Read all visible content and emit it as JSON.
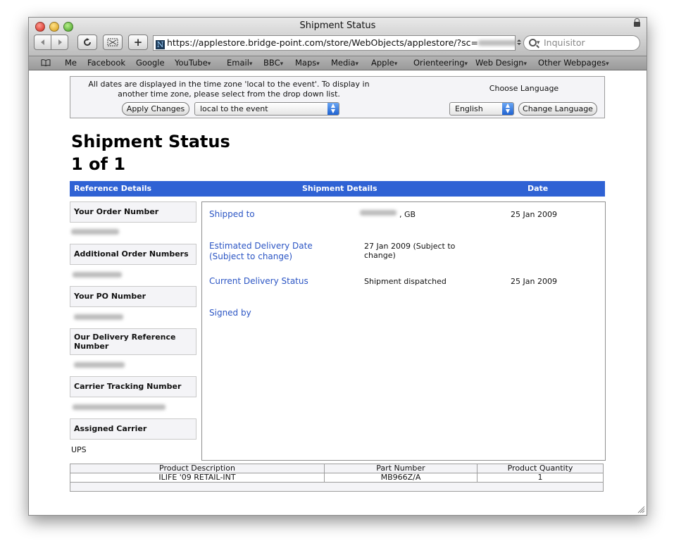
{
  "window": {
    "title": "Shipment Status"
  },
  "toolbar": {
    "back_icon": "back-arrow-icon",
    "forward_icon": "forward-arrow-icon",
    "reload_icon": "reload-icon",
    "url": "https://applestore.bridge-point.com/store/WebObjects/applestore/?sc=",
    "search_placeholder": "Inquisitor",
    "add_label": "+"
  },
  "bookmarks": [
    {
      "label": "Me",
      "menu": false
    },
    {
      "label": "Facebook",
      "menu": false
    },
    {
      "label": "Google",
      "menu": false
    },
    {
      "label": "YouTube",
      "menu": true
    },
    {
      "label": "Email",
      "menu": true
    },
    {
      "label": "BBC",
      "menu": true
    },
    {
      "label": "Maps",
      "menu": true
    },
    {
      "label": "Media",
      "menu": true
    },
    {
      "label": "Apple",
      "menu": true
    },
    {
      "label": "Orienteering",
      "menu": true
    },
    {
      "label": "Web Design",
      "menu": true
    },
    {
      "label": "Other Webpages",
      "menu": true
    }
  ],
  "timezone": {
    "notice": "All dates are displayed in the time zone 'local to the event'. To display in another time zone, please select from the drop down list.",
    "apply_label": "Apply Changes",
    "selected": "local to the event",
    "language_heading": "Choose Language",
    "language_selected": "English",
    "change_language_label": "Change Language"
  },
  "page": {
    "title": "Shipment Status",
    "counter": "1 of 1"
  },
  "table_header": {
    "reference": "Reference Details",
    "shipment": "Shipment Details",
    "date": "Date"
  },
  "reference": [
    {
      "label": "Your Order Number",
      "value": ""
    },
    {
      "label": "Additional Order Numbers",
      "value": ""
    },
    {
      "label": "Your PO Number",
      "value": ""
    },
    {
      "label": "Our Delivery Reference Number",
      "value": ""
    },
    {
      "label": "Carrier Tracking Number",
      "value": ""
    },
    {
      "label": "Assigned Carrier",
      "value": "UPS"
    }
  ],
  "shipment": [
    {
      "label": "Shipped to",
      "value": ", GB",
      "date": "25 Jan 2009"
    },
    {
      "label": "Estimated Delivery Date (Subject to change)",
      "value": "27 Jan 2009 (Subject to change)",
      "date": ""
    },
    {
      "label": "Current Delivery Status",
      "value": "Shipment dispatched",
      "date": "25 Jan 2009"
    },
    {
      "label": "Signed by",
      "value": "",
      "date": ""
    }
  ],
  "products": {
    "headers": [
      "Product Description",
      "Part Number",
      "Product Quantity"
    ],
    "rows": [
      [
        "ILIFE '09 RETAIL-INT",
        "MB966Z/A",
        "1"
      ]
    ]
  }
}
